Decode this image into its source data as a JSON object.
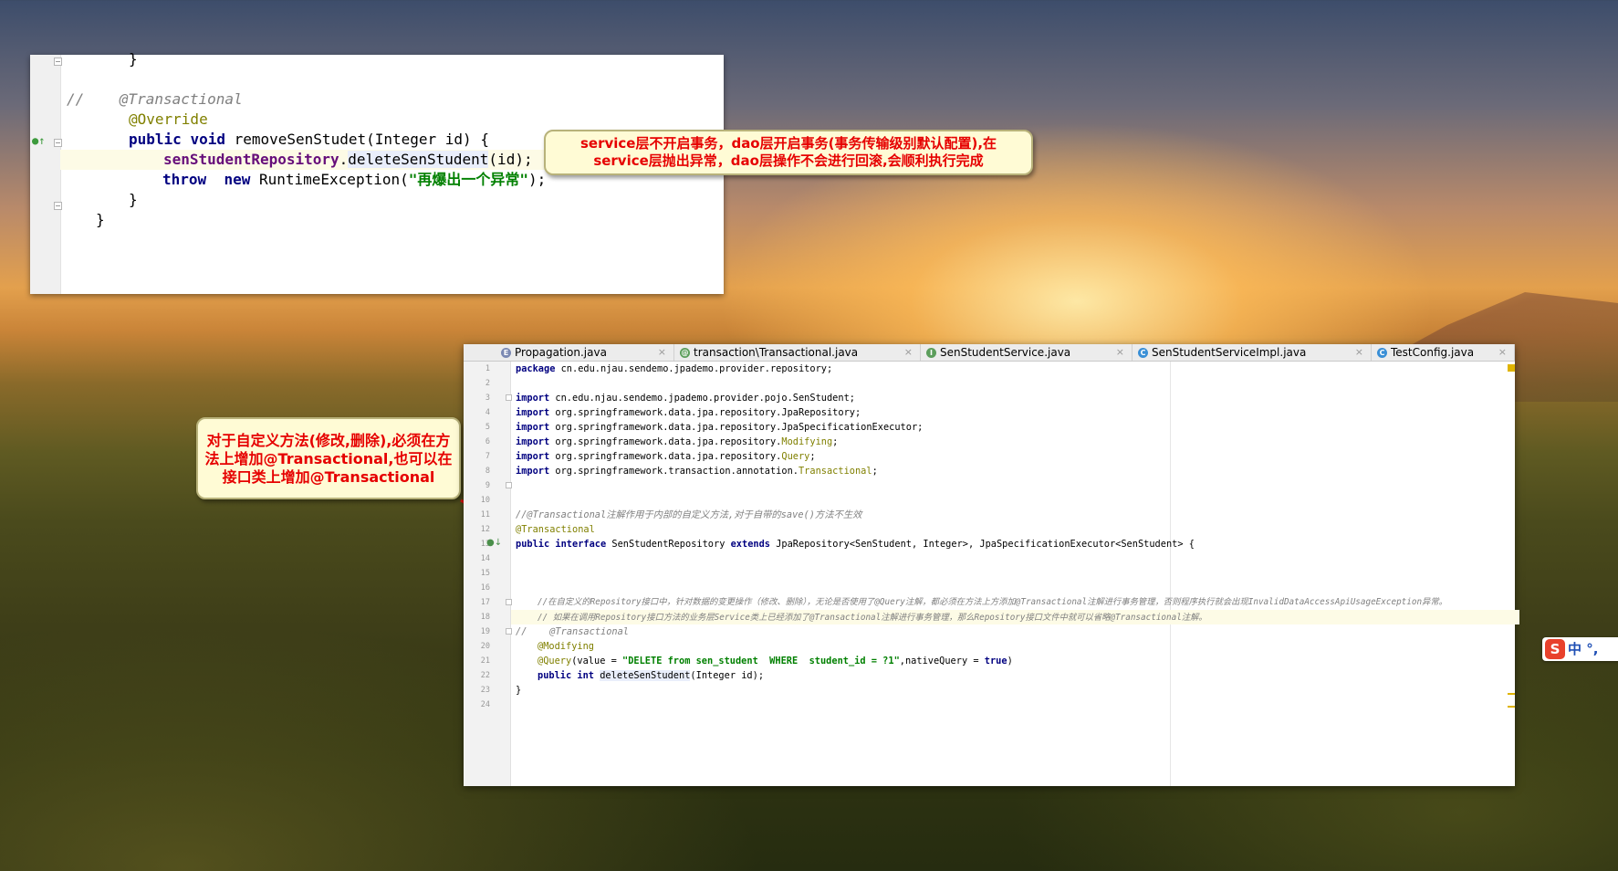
{
  "top_panel": {
    "lines": [
      "}",
      "",
      "//    @Transactional",
      "@Override",
      "public void removeSenStudet(Integer id) {",
      "senStudentRepository.deleteSenStudent(id);",
      "throw  new RuntimeException(\"再爆出一个异常\");",
      "}",
      "}"
    ],
    "tokens": {
      "comment_slashes": "//",
      "comment_annotation": "@Transactional",
      "override": "@Override",
      "kw_public": "public",
      "kw_void": "void",
      "method_sig": " removeSenStudet(Integer id) {",
      "field": "senStudentRepository",
      "dot": ".",
      "call": "deleteSenStudent",
      "call_args": "(id);",
      "kw_throw": "throw",
      "kw_new": "new",
      "exc_class": " RuntimeException(",
      "exc_msg": "\"再爆出一个异常\"",
      "exc_end": ");",
      "brace": "}"
    }
  },
  "callout_1": {
    "line1": "service层不开启事务，dao层开启事务(事务传输级别默认配置),在",
    "line2": "service层抛出异常，dao层操作不会进行回滚,会顺利执行完成"
  },
  "callout_2": {
    "line1": "对于自定义方法(修改,删除),必须在方",
    "line2": "法上增加@Transactional,也可以在",
    "line3": "接口类上增加@Transactional"
  },
  "ide": {
    "tabs": [
      {
        "label": "Propagation.java",
        "icon": "E",
        "icon_color": "#7b89b3"
      },
      {
        "label": "transaction\\Transactional.java",
        "icon": "@",
        "icon_color": "#5c9e5c"
      },
      {
        "label": "SenStudentService.java",
        "icon": "I",
        "icon_color": "#5c9e5c"
      },
      {
        "label": "SenStudentServiceImpl.java",
        "icon": "C",
        "icon_color": "#3a8fd6"
      },
      {
        "label": "TestConfig.java",
        "icon": "C",
        "icon_color": "#3a8fd6"
      }
    ],
    "tab_close": "×",
    "line_numbers": [
      "1",
      "2",
      "3",
      "4",
      "5",
      "6",
      "7",
      "8",
      "9",
      "10",
      "11",
      "12",
      "13",
      "14",
      "15",
      "16",
      "17",
      "18",
      "19",
      "20",
      "21",
      "22",
      "23",
      "24"
    ],
    "code": {
      "l1_kw": "package",
      "l1_rest": " cn.edu.njau.sendemo.jpademo.provider.repository;",
      "import_kw": "import",
      "l3": " cn.edu.njau.sendemo.jpademo.provider.pojo.SenStudent;",
      "l4": " org.springframework.data.jpa.repository.JpaRepository;",
      "l5": " org.springframework.data.jpa.repository.JpaSpecificationExecutor;",
      "l6_a": " org.springframework.data.jpa.repository.",
      "l6_b": "Modifying",
      "l6_c": ";",
      "l7_a": " org.springframework.data.jpa.repository.",
      "l7_b": "Query",
      "l7_c": ";",
      "l8_a": " org.springframework.transaction.annotation.",
      "l8_b": "Transactional",
      "l8_c": ";",
      "l11": "//@Transactional注解作用于内部的自定义方法,对于自带的save()方法不生效",
      "l12": "@Transactional",
      "l13_public": "public",
      "l13_interface": "interface",
      "l13_name": " SenStudentRepository ",
      "l13_extends": "extends",
      "l13_rest": " JpaRepository<SenStudent, Integer>, JpaSpecificationExecutor<SenStudent> {",
      "l17": "//在自定义的Repository接口中，针对数据的变更操作（修改、删除），无论是否使用了@Query注解，都必须在方法上方添加@Transactional注解进行事务管理，否则程序执行就会出现InvalidDataAccessApiUsageException异常。",
      "l18": "// 如果在调用Repository接口方法的业务层Service类上已经添加了@Transactional注解进行事务管理，那么Repository接口文件中就可以省略@Transactional注解。",
      "l19_a": "//",
      "l19_b": "@Transactional",
      "l20": "@Modifying",
      "l21_a": "@Query",
      "l21_b": "(value = ",
      "l21_c": "\"DELETE from sen_student  WHERE  student_id = ?1\"",
      "l21_d": ",nativeQuery = ",
      "l21_e": "true",
      "l21_f": ")",
      "l22_public": "public",
      "l22_int": "int",
      "l22_name": "deleteSenStudent",
      "l22_rest": "(Integer id);",
      "l23": "}"
    }
  },
  "ime": {
    "logo": "S",
    "text": "中 °, "
  }
}
